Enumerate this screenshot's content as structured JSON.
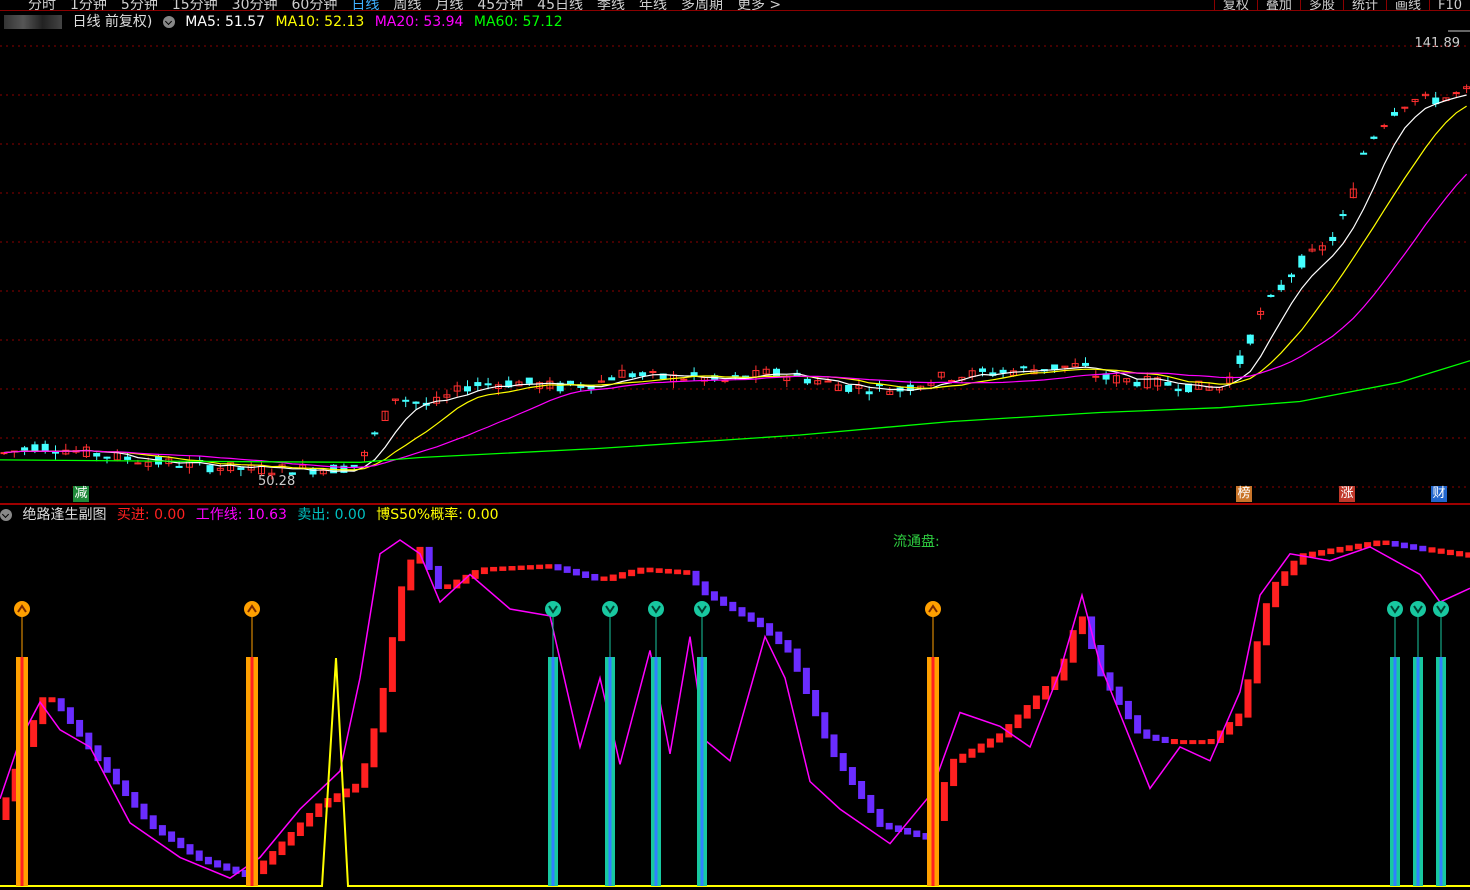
{
  "toolbar": {
    "periods": [
      "分时",
      "1分钟",
      "5分钟",
      "15分钟",
      "30分钟",
      "60分钟",
      "日线",
      "周线",
      "月线",
      "45分钟",
      "45日线",
      "季线",
      "年线",
      "多周期",
      "更多 >"
    ],
    "active_period": "日线",
    "actions": [
      "复权",
      "叠加",
      "多股",
      "统计",
      "画线",
      "F10"
    ]
  },
  "main_legend": {
    "title": "日线 前复权)",
    "items": [
      {
        "label": "MA5: 51.57",
        "color": "#ffffff"
      },
      {
        "label": "MA10: 52.13",
        "color": "#ffff00"
      },
      {
        "label": "MA20: 53.94",
        "color": "#ff00ff"
      },
      {
        "label": "MA60: 57.12",
        "color": "#00ff00"
      }
    ]
  },
  "price_axis": {
    "max_label": "141.89",
    "min_label": "50.28"
  },
  "tags": [
    {
      "text": "减",
      "color": "#1f8a3a",
      "pos": "left"
    },
    {
      "text": "榜",
      "color": "#c9752a",
      "pos": "mid-right"
    },
    {
      "text": "涨",
      "color": "#c0392b",
      "pos": "right"
    },
    {
      "text": "财",
      "color": "#2266cc",
      "pos": "far-right"
    }
  ],
  "sub_legend": {
    "title": "绝路逢生副图",
    "items": [
      {
        "label": "买进: 0.00",
        "color": "#ff2020"
      },
      {
        "label": "工作线: 10.63",
        "color": "#ff00ff"
      },
      {
        "label": "卖出: 0.00",
        "color": "#00c0c0"
      },
      {
        "label": "博S50%概率: 0.00",
        "color": "#ffff00"
      }
    ]
  },
  "sub_note": "流通盘:",
  "colors": {
    "up": "#ff3030",
    "down": "#44ffff",
    "ma5": "#ffffff",
    "ma10": "#ffff00",
    "ma20": "#ff00ff",
    "ma60": "#00ff00",
    "buy_bar": "#ff2020",
    "sell_bar": "#6a2cff",
    "buy_signal": "#ffa000",
    "sell_signal": "#18c8a0",
    "probability": "#ffff00",
    "grid": "#8b0000"
  }
}
